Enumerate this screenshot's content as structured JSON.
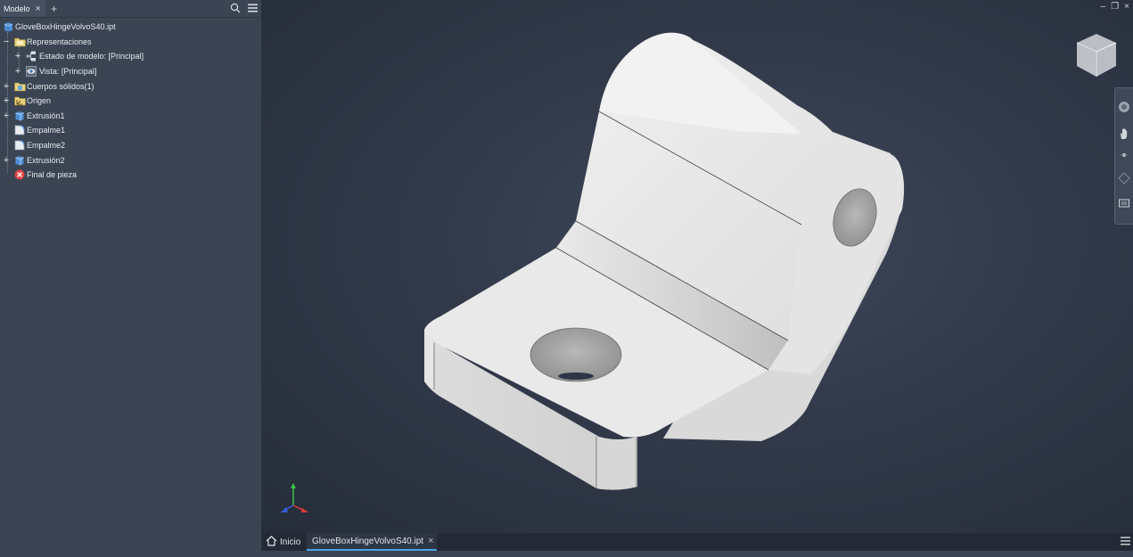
{
  "browser": {
    "tab_label": "Modelo",
    "add_label": "+",
    "close_glyph": "×",
    "icons": {
      "search": "search-icon",
      "menu": "hamburger-menu-icon"
    },
    "tree": [
      {
        "label": "GloveBoxHingeVolvoS40.ipt",
        "icon": "part-icon"
      },
      {
        "label": "Representaciones",
        "icon": "folder-icon",
        "expander": "−"
      },
      {
        "label": "Estado de modelo: [Principal]",
        "icon": "model-state-icon",
        "expander": "+"
      },
      {
        "label": "Vista: [Principal]",
        "icon": "view-icon",
        "expander": "+"
      },
      {
        "label": "Cuerpos sólidos(1)",
        "icon": "folder-icon",
        "expander": "+"
      },
      {
        "label": "Origen",
        "icon": "origin-folder-icon",
        "expander": "+"
      },
      {
        "label": "Extrusión1",
        "icon": "extrusion-icon",
        "expander": "+"
      },
      {
        "label": "Empalme1",
        "icon": "fillet-icon"
      },
      {
        "label": "Empalme2",
        "icon": "fillet-icon"
      },
      {
        "label": "Extrusión2",
        "icon": "extrusion-icon",
        "expander": "+"
      },
      {
        "label": "Final de pieza",
        "icon": "end-of-part-icon"
      }
    ]
  },
  "viewport": {
    "window_controls": [
      "–",
      "❐",
      "×"
    ],
    "triad": {
      "x_color": "#e03c3c",
      "y_color": "#3cc24a",
      "z_color": "#3a5be0"
    }
  },
  "doc_tabs": {
    "home_label": "Inicio",
    "active_label": "GloveBoxHingeVolvoS40.ipt",
    "close_glyph": "×"
  },
  "colors": {
    "accent": "#4aa3e6",
    "panel": "#3b4453",
    "viewport": "#2f3746",
    "part": "#e6e6e6"
  }
}
